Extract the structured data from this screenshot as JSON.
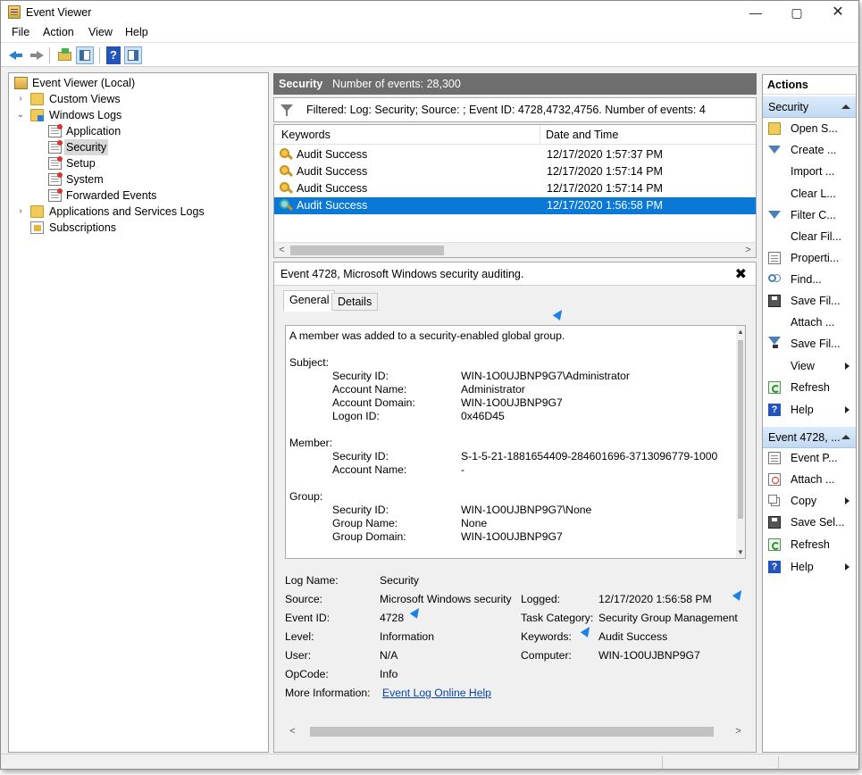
{
  "window": {
    "title": "Event Viewer",
    "controls": {
      "minimize": "—",
      "maximize": "▢",
      "close": "✕"
    }
  },
  "menu": [
    "File",
    "Action",
    "View",
    "Help"
  ],
  "toolbar": {
    "icons": [
      "back-arrow-icon",
      "forward-arrow-icon",
      "up-folder-icon",
      "show-hide-console-tree-icon",
      "help-icon",
      "show-hide-action-pane-icon"
    ],
    "help_glyph": "?"
  },
  "tree": {
    "root": "Event Viewer (Local)",
    "custom_views": "Custom Views",
    "windows_logs": "Windows Logs",
    "logs": [
      "Application",
      "Security",
      "Setup",
      "System",
      "Forwarded Events"
    ],
    "apps_services": "Applications and Services Logs",
    "subscriptions": "Subscriptions",
    "selected": "Security",
    "chevron_collapsed": "›",
    "chevron_expanded": "⌄"
  },
  "log_header": {
    "name": "Security",
    "count_text": "Number of events: 28,300"
  },
  "filter": {
    "text": "Filtered: Log: Security; Source: ; Event ID: 4728,4732,4756. Number of events: 4"
  },
  "events": {
    "columns": {
      "keywords": "Keywords",
      "date": "Date and Time"
    },
    "rows": [
      {
        "keyword": "Audit Success",
        "datetime": "12/17/2020 1:57:37 PM"
      },
      {
        "keyword": "Audit Success",
        "datetime": "12/17/2020 1:57:14 PM"
      },
      {
        "keyword": "Audit Success",
        "datetime": "12/17/2020 1:57:14 PM"
      },
      {
        "keyword": "Audit Success",
        "datetime": "12/17/2020 1:56:58 PM"
      }
    ],
    "selected_index": 3,
    "scroll_left": "<",
    "scroll_right": ">"
  },
  "detail": {
    "title": "Event 4728, Microsoft Windows security auditing.",
    "close": "✖",
    "tabs": [
      "General",
      "Details"
    ],
    "description": {
      "intro": "A member was added to a security-enabled global group.",
      "subject_label": "Subject:",
      "subject": [
        {
          "k": "Security ID:",
          "v": "WIN-1O0UJBNP9G7\\Administrator"
        },
        {
          "k": "Account Name:",
          "v": "Administrator"
        },
        {
          "k": "Account Domain:",
          "v": "WIN-1O0UJBNP9G7"
        },
        {
          "k": "Logon ID:",
          "v": "0x46D45"
        }
      ],
      "member_label": "Member:",
      "member": [
        {
          "k": "Security ID:",
          "v": "S-1-5-21-1881654409-284601696-3713096779-1000"
        },
        {
          "k": "Account Name:",
          "v": "-"
        }
      ],
      "group_label": "Group:",
      "group": [
        {
          "k": "Security ID:",
          "v": "WIN-1O0UJBNP9G7\\None"
        },
        {
          "k": "Group Name:",
          "v": "None"
        },
        {
          "k": "Group Domain:",
          "v": "WIN-1O0UJBNP9G7"
        }
      ],
      "scroll_up": "▲",
      "scroll_down": "▼"
    },
    "props": {
      "log_name_label": "Log Name:",
      "log_name": "Security",
      "source_label": "Source:",
      "source": "Microsoft Windows security",
      "logged_label": "Logged:",
      "logged": "12/17/2020 1:56:58 PM",
      "event_id_label": "Event ID:",
      "event_id": "4728",
      "task_label": "Task Category:",
      "task": "Security Group Management",
      "level_label": "Level:",
      "level": "Information",
      "keywords_label": "Keywords:",
      "keywords": "Audit Success",
      "user_label": "User:",
      "user": "N/A",
      "computer_label": "Computer:",
      "computer": "WIN-1O0UJBNP9G7",
      "opcode_label": "OpCode:",
      "opcode": "Info",
      "more_label": "More Information:",
      "more_link": "Event Log Online Help"
    },
    "scroll_left": "<",
    "scroll_right": ">"
  },
  "actions": {
    "header": "Actions",
    "section1": "Security",
    "items1": [
      {
        "label": "Open S...",
        "icon": "open-saved-log-icon"
      },
      {
        "label": "Create ...",
        "icon": "create-custom-view-icon"
      },
      {
        "label": "Import ...",
        "icon": ""
      },
      {
        "label": "Clear L...",
        "icon": ""
      },
      {
        "label": "Filter C...",
        "icon": "filter-icon"
      },
      {
        "label": "Clear Fil...",
        "icon": ""
      },
      {
        "label": "Properti...",
        "icon": "properties-icon"
      },
      {
        "label": "Find...",
        "icon": "find-icon"
      },
      {
        "label": "Save Fil...",
        "icon": "save-icon"
      },
      {
        "label": "Attach ...",
        "icon": ""
      },
      {
        "label": "Save Fil...",
        "icon": "save-filter-icon"
      },
      {
        "label": "View",
        "icon": ""
      },
      {
        "label": "Refresh",
        "icon": "refresh-icon"
      },
      {
        "label": "Help",
        "icon": "help-icon"
      }
    ],
    "section2": "Event 4728, ...",
    "items2": [
      {
        "label": "Event P...",
        "icon": "event-properties-icon"
      },
      {
        "label": "Attach ...",
        "icon": "attach-task-icon"
      },
      {
        "label": "Copy",
        "icon": "copy-icon"
      },
      {
        "label": "Save Sel...",
        "icon": "save-icon"
      },
      {
        "label": "Refresh",
        "icon": "refresh-icon"
      },
      {
        "label": "Help",
        "icon": "help-icon"
      }
    ],
    "help_glyph": "?"
  },
  "colors": {
    "selection": "#0a78d7",
    "header_gray": "#6e6e6e",
    "action_section": "#c3daf2",
    "link": "#0645ad",
    "cursor": "#1a82e6"
  }
}
